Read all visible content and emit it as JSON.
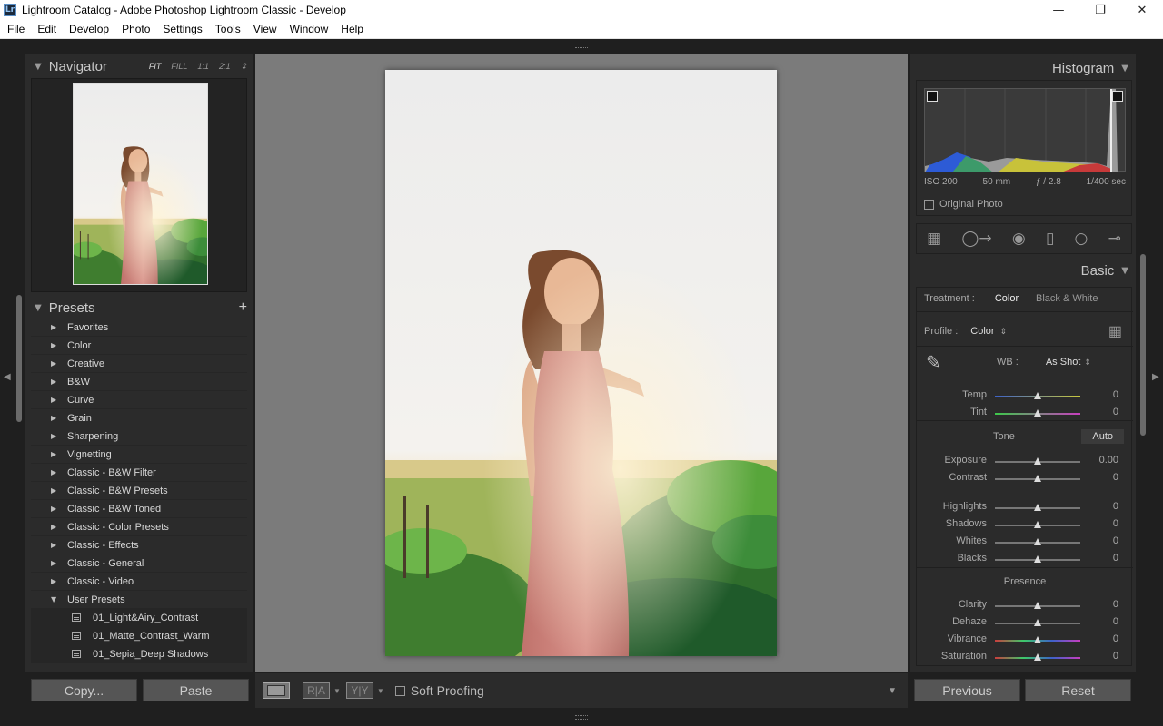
{
  "window": {
    "title": "Lightroom Catalog - Adobe Photoshop Lightroom Classic - Develop",
    "app_icon": "Lr",
    "controls": {
      "minimize": "—",
      "restore": "❐",
      "close": "✕"
    }
  },
  "menu": [
    "File",
    "Edit",
    "Develop",
    "Photo",
    "Settings",
    "Tools",
    "View",
    "Window",
    "Help"
  ],
  "navigator": {
    "title": "Navigator",
    "options": [
      "FIT",
      "FILL",
      "1:1",
      "2:1"
    ],
    "spinner": "⇕"
  },
  "presets": {
    "title": "Presets",
    "add": "+",
    "groups": [
      "Favorites",
      "Color",
      "Creative",
      "B&W",
      "Curve",
      "Grain",
      "Sharpening",
      "Vignetting",
      "Classic - B&W Filter",
      "Classic - B&W Presets",
      "Classic - B&W Toned",
      "Classic - Color Presets",
      "Classic - Effects",
      "Classic - General",
      "Classic - Video",
      "User Presets"
    ],
    "user_items": [
      "01_Light&Airy_Contrast",
      "01_Matte_Contrast_Warm",
      "01_Sepia_Deep Shadows"
    ]
  },
  "left_buttons": {
    "copy": "Copy...",
    "paste": "Paste"
  },
  "toolbar": {
    "compare_ra": "R|A",
    "compare_yy": "Y|Y",
    "soft_proofing": "Soft Proofing"
  },
  "histogram": {
    "title": "Histogram",
    "iso": "ISO 200",
    "focal": "50 mm",
    "aperture": "ƒ / 2.8",
    "shutter": "1/400 sec",
    "original_photo": "Original Photo"
  },
  "basic": {
    "title": "Basic",
    "treatment_label": "Treatment :",
    "treatment_color": "Color",
    "treatment_bw": "Black & White",
    "profile_label": "Profile :",
    "profile_value": "Color",
    "wb_label": "WB :",
    "wb_value": "As Shot",
    "tone_label": "Tone",
    "auto": "Auto",
    "presence_label": "Presence",
    "sliders": [
      {
        "label": "Temp",
        "value": "0",
        "position": 0.5
      },
      {
        "label": "Tint",
        "value": "0",
        "position": 0.5
      },
      {
        "label": "Exposure",
        "value": "0.00",
        "position": 0.5
      },
      {
        "label": "Contrast",
        "value": "0",
        "position": 0.5
      },
      {
        "label": "Highlights",
        "value": "0",
        "position": 0.5
      },
      {
        "label": "Shadows",
        "value": "0",
        "position": 0.5
      },
      {
        "label": "Whites",
        "value": "0",
        "position": 0.5
      },
      {
        "label": "Blacks",
        "value": "0",
        "position": 0.5
      },
      {
        "label": "Clarity",
        "value": "0",
        "position": 0.5
      },
      {
        "label": "Dehaze",
        "value": "0",
        "position": 0.5
      },
      {
        "label": "Vibrance",
        "value": "0",
        "position": 0.5
      },
      {
        "label": "Saturation",
        "value": "0",
        "position": 0.5
      }
    ]
  },
  "right_buttons": {
    "previous": "Previous",
    "reset": "Reset"
  },
  "icons": [
    "grid-overlay-icon",
    "crop-icon",
    "spot-removal-icon",
    "red-eye-icon",
    "graduated-filter-icon",
    "radial-filter-icon",
    "brush-icon",
    "eyedropper-icon",
    "profile-browser-icon",
    "dropdown-triangle-icon"
  ]
}
